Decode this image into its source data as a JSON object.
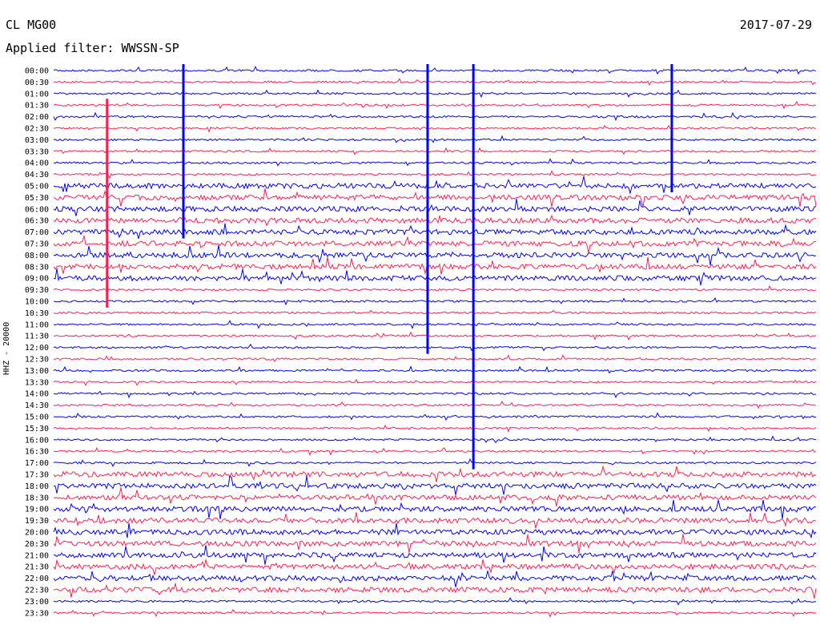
{
  "header": {
    "station": "CL MG00",
    "filter_label": "Applied filter: WWSSN-SP",
    "date": "2017-07-29"
  },
  "chart_data": {
    "type": "line",
    "title": "CL MG00",
    "subtitle": "Applied filter: WWSSN-SP",
    "ylabel": "HHZ - 20000",
    "colors": [
      "#0000ff",
      "#ff1e50"
    ],
    "trace_colors_alternate": true,
    "rows": [
      "00:00",
      "00:30",
      "01:00",
      "01:30",
      "02:00",
      "02:30",
      "03:00",
      "03:30",
      "04:00",
      "04:30",
      "05:00",
      "05:30",
      "06:00",
      "06:30",
      "07:00",
      "07:30",
      "08:00",
      "08:30",
      "09:00",
      "09:30",
      "10:00",
      "10:30",
      "11:00",
      "11:30",
      "12:00",
      "12:30",
      "13:00",
      "13:30",
      "14:00",
      "14:30",
      "15:00",
      "15:30",
      "16:00",
      "16:30",
      "17:00",
      "17:30",
      "18:00",
      "18:30",
      "19:00",
      "19:30",
      "20:00",
      "20:30",
      "21:00",
      "21:30",
      "22:00",
      "22:30",
      "23:00",
      "23:30"
    ],
    "events": [
      {
        "time": 0.07,
        "rows": [
          3,
          20
        ]
      },
      {
        "time": 0.17,
        "rows": [
          0,
          14
        ]
      },
      {
        "time": 0.49,
        "rows": [
          0,
          24
        ]
      },
      {
        "time": 0.55,
        "rows": [
          0,
          34
        ]
      },
      {
        "time": 0.81,
        "rows": [
          0,
          10
        ]
      }
    ]
  }
}
